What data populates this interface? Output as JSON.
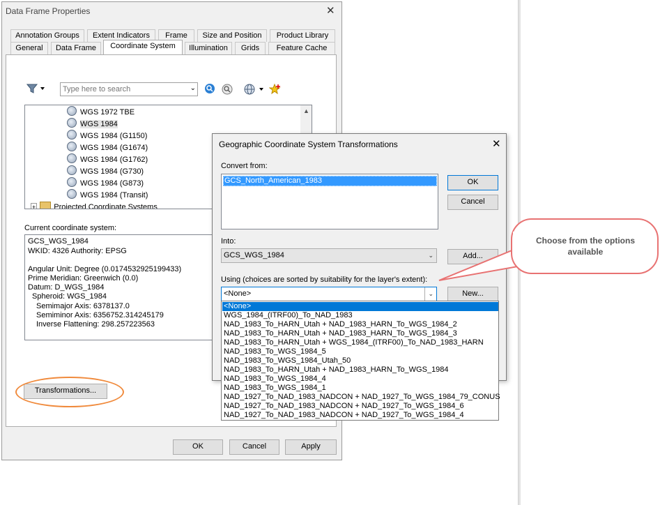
{
  "main_dialog": {
    "title": "Data Frame Properties",
    "close_glyph": "✕",
    "tabs_row1": [
      "Annotation Groups",
      "Extent Indicators",
      "Frame",
      "Size and Position",
      "Product Library"
    ],
    "tabs_row2": [
      "General",
      "Data Frame",
      "Coordinate System",
      "Illumination",
      "Grids",
      "Feature Cache"
    ],
    "active_tab": "Coordinate System",
    "search_placeholder": "Type here to search",
    "tree_items": [
      "WGS 1972 TBE",
      "WGS 1984",
      "WGS 1984 (G1150)",
      "WGS 1984 (G1674)",
      "WGS 1984 (G1762)",
      "WGS 1984 (G730)",
      "WGS 1984 (G873)",
      "WGS 1984 (Transit)"
    ],
    "tree_partial": "Projected Coordinate Systems",
    "current_label": "Current coordinate system:",
    "current_lines": [
      "GCS_WGS_1984",
      "WKID: 4326 Authority: EPSG",
      "",
      "Angular Unit: Degree (0.0174532925199433)",
      "Prime Meridian: Greenwich (0.0)",
      "Datum: D_WGS_1984",
      "  Spheroid: WGS_1984",
      "    Semimajor Axis: 6378137.0",
      "    Semiminor Axis: 6356752.314245179",
      "    Inverse Flattening: 298.257223563"
    ],
    "transformations_button": "Transformations...",
    "ok": "OK",
    "cancel": "Cancel",
    "apply": "Apply"
  },
  "transform_dialog": {
    "title": "Geographic Coordinate System Transformations",
    "close_glyph": "✕",
    "convert_from_label": "Convert from:",
    "convert_from_value": "GCS_North_American_1983",
    "into_label": "Into:",
    "into_value": "GCS_WGS_1984",
    "using_label": "Using (choices are sorted by suitability for the layer's extent):",
    "using_value": "<None>",
    "ok": "OK",
    "cancel": "Cancel",
    "add": "Add...",
    "new": "New...",
    "options": [
      "<None>",
      "WGS_1984_(ITRF00)_To_NAD_1983",
      "NAD_1983_To_HARN_Utah + NAD_1983_HARN_To_WGS_1984_2",
      "NAD_1983_To_HARN_Utah + NAD_1983_HARN_To_WGS_1984_3",
      "NAD_1983_To_HARN_Utah + WGS_1984_(ITRF00)_To_NAD_1983_HARN",
      "NAD_1983_To_WGS_1984_5",
      "NAD_1983_To_WGS_1984_Utah_50",
      "NAD_1983_To_HARN_Utah + NAD_1983_HARN_To_WGS_1984",
      "NAD_1983_To_WGS_1984_4",
      "NAD_1983_To_WGS_1984_1",
      "NAD_1927_To_NAD_1983_NADCON + NAD_1927_To_WGS_1984_79_CONUS",
      "NAD_1927_To_NAD_1983_NADCON + NAD_1927_To_WGS_1984_6",
      "NAD_1927_To_NAD_1983_NADCON + NAD_1927_To_WGS_1984_4"
    ]
  },
  "callout": {
    "text": "Choose from the options available"
  },
  "colors": {
    "selection": "#0078d7",
    "callout_border": "#e87272",
    "highlight": "#f08a3c"
  }
}
